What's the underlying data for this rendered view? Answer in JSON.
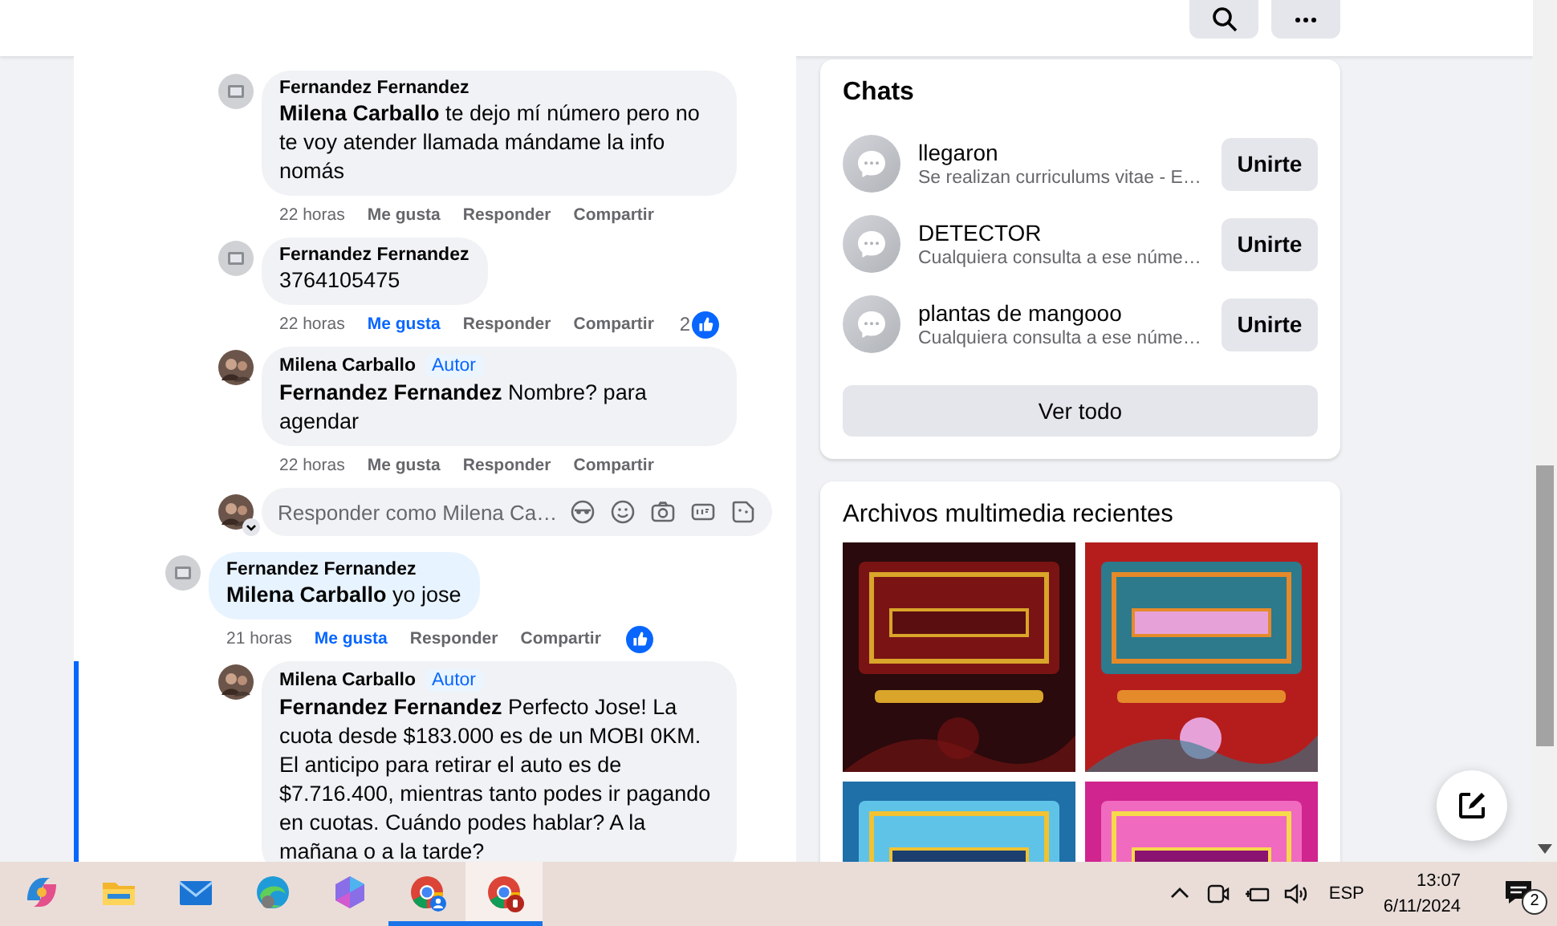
{
  "top_bar": {
    "buttons": [
      {
        "kind": "search"
      },
      {
        "kind": "more"
      }
    ]
  },
  "thread": {
    "replies": [
      {
        "author": "Fernandez Fernandez",
        "avatar": {
          "kind": "placeholder"
        },
        "text": "**Milena Carballo** te dejo mí número pero no te voy atender llamada mándame la info nomás",
        "time": "22 horas",
        "like_label": "Me gusta",
        "reply_label": "Responder",
        "share_label": "Compartir",
        "liked": false
      },
      {
        "author": "Fernandez Fernandez",
        "avatar": {
          "kind": "placeholder"
        },
        "text": "3764105475",
        "time": "22 horas",
        "like_label": "Me gusta",
        "reply_label": "Responder",
        "share_label": "Compartir",
        "liked": true,
        "reaction_count": "2",
        "reacted": true
      },
      {
        "author": "Milena Carballo",
        "badge": "Autor",
        "text": "**Fernandez Fernandez** Nombre? para agendar",
        "time": "22 horas",
        "like_label": "Me gusta",
        "reply_label": "Responder",
        "share_label": "Compartir",
        "liked": false
      }
    ],
    "reply_box": {
      "placeholder": "Responder como Milena Ca…"
    },
    "comment": {
      "author": "Fernandez Fernandez",
      "avatar": {
        "kind": "placeholder"
      },
      "text": "**Milena Carballo** yo jose",
      "time": "21 horas",
      "like_label": "Me gusta",
      "reply_label": "Responder",
      "share_label": "Compartir",
      "liked": true,
      "highlighted": true,
      "reacted": true,
      "children": [
        {
          "author": "Milena Carballo",
          "badge": "Autor",
          "text": "**Fernandez Fernandez** Perfecto Jose! La cuota desde $183.000 es de un MOBI 0KM. El anticipo para retirar el auto es de $7.716.400, mientras tanto podes ir pagando en cuotas. Cuándo podes hablar? A la mañana o a la tarde?"
        }
      ]
    }
  },
  "chats": {
    "title": "Chats",
    "items": [
      {
        "name": "llegaron",
        "preview": "Se realizan curriculums vitae - E…",
        "button": "Unirte"
      },
      {
        "name": "DETECTOR",
        "preview": "Cualquiera consulta a ese núme…",
        "button": "Unirte"
      },
      {
        "name": "plantas de mangooo",
        "preview": "Cualquiera consulta a ese núme…",
        "button": "Unirte"
      }
    ],
    "see_all": "Ver todo"
  },
  "media": {
    "title": "Archivos multimedia recientes"
  },
  "taskbar": {
    "apps": [
      {
        "kind": "copilot",
        "running": false,
        "selected": false
      },
      {
        "kind": "folder",
        "running": false,
        "selected": false
      },
      {
        "kind": "mail",
        "running": false,
        "selected": false
      },
      {
        "kind": "edge",
        "running": false,
        "selected": false
      },
      {
        "kind": "hexagon",
        "running": false,
        "selected": false
      },
      {
        "kind": "chrome",
        "running": true,
        "selected": false
      },
      {
        "kind": "chrome-b",
        "running": true,
        "selected": true
      }
    ],
    "language": "ESP",
    "time": "13:07",
    "date": "6/11/2024",
    "notification_count": "2"
  }
}
